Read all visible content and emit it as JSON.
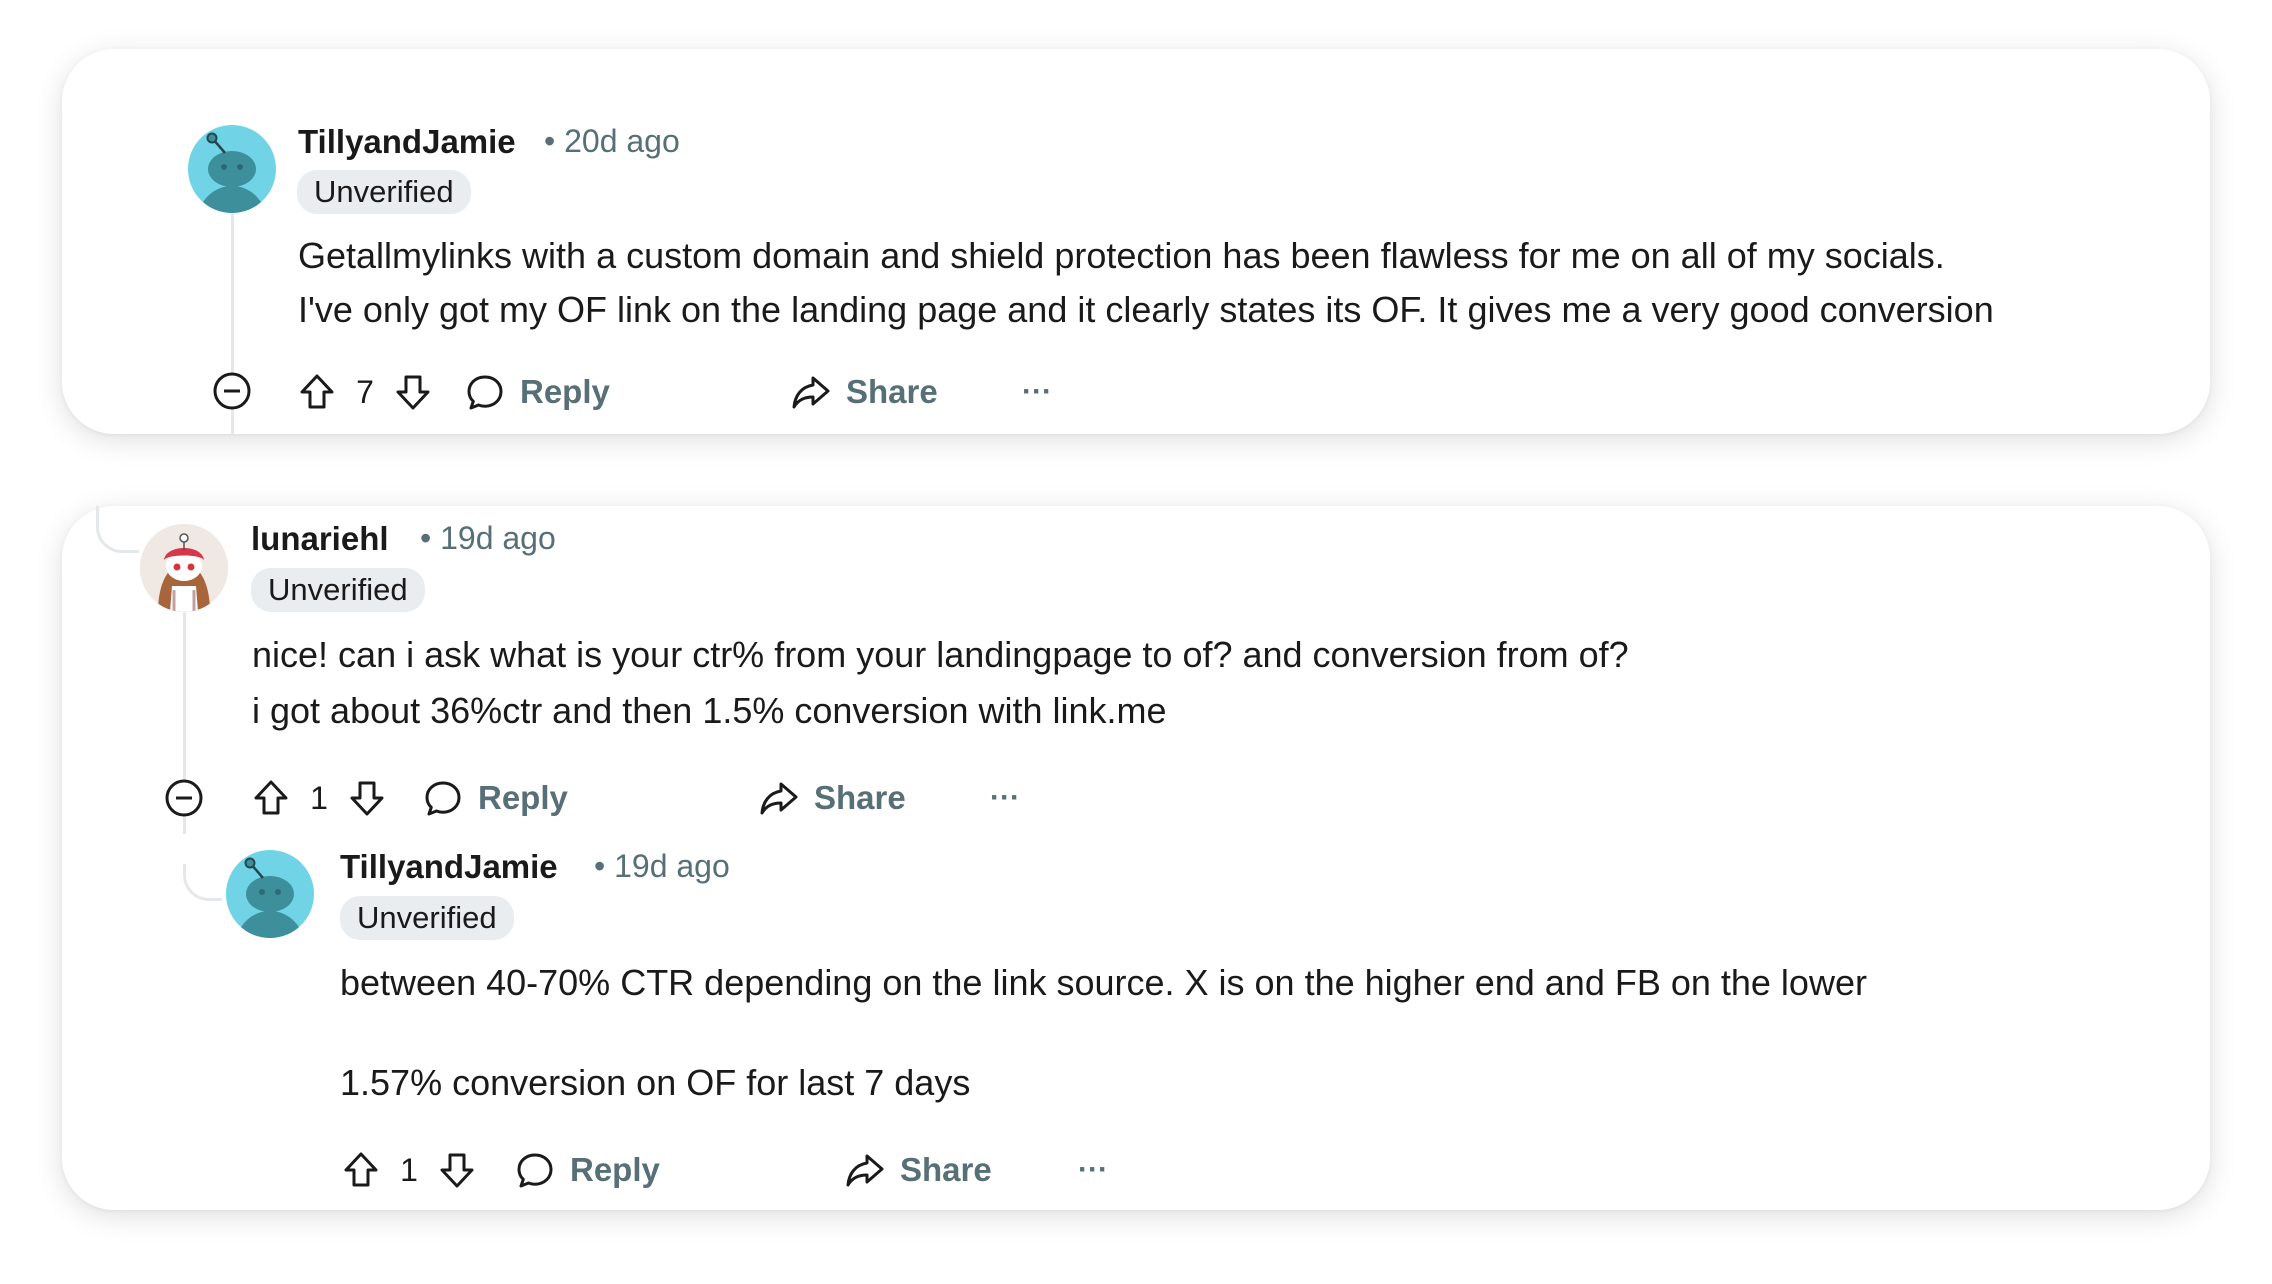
{
  "comments": [
    {
      "username": "TillyandJamie",
      "meta": "• 20d ago",
      "badge": "Unverified",
      "lines": [
        "Getallmylinks with a custom domain and shield protection has been flawless for me on all of my socials.",
        "I've only got my OF link on the landing page and it clearly states its OF. It gives me a very good conversion"
      ],
      "score": "7",
      "reply_label": "Reply",
      "share_label": "Share",
      "more_label": "···"
    },
    {
      "username": "lunariehl",
      "meta": "• 19d ago",
      "badge": "Unverified",
      "lines": [
        "nice! can i ask what is your ctr% from your landingpage to of? and conversion from of?",
        "i got about 36%ctr and then 1.5% conversion with link.me"
      ],
      "score": "1",
      "reply_label": "Reply",
      "share_label": "Share",
      "more_label": "···"
    },
    {
      "username": "TillyandJamie",
      "meta": "• 19d ago",
      "badge": "Unverified",
      "lines": [
        "between 40-70% CTR depending on the link source. X is on the higher end and FB on the lower",
        "1.57% conversion on OF for last 7 days"
      ],
      "score": "1",
      "reply_label": "Reply",
      "share_label": "Share",
      "more_label": "···"
    }
  ],
  "colors": {
    "avatar_teal": "#70d4e6",
    "meta_gray": "#576f76",
    "badge_bg": "#eaedef",
    "thread_line": "#e5e8ea"
  },
  "icons": [
    "snoo-avatar-icon",
    "user-photo-avatar",
    "collapse-icon",
    "upvote-icon",
    "downvote-icon",
    "comment-bubble-icon",
    "share-arrow-icon"
  ]
}
